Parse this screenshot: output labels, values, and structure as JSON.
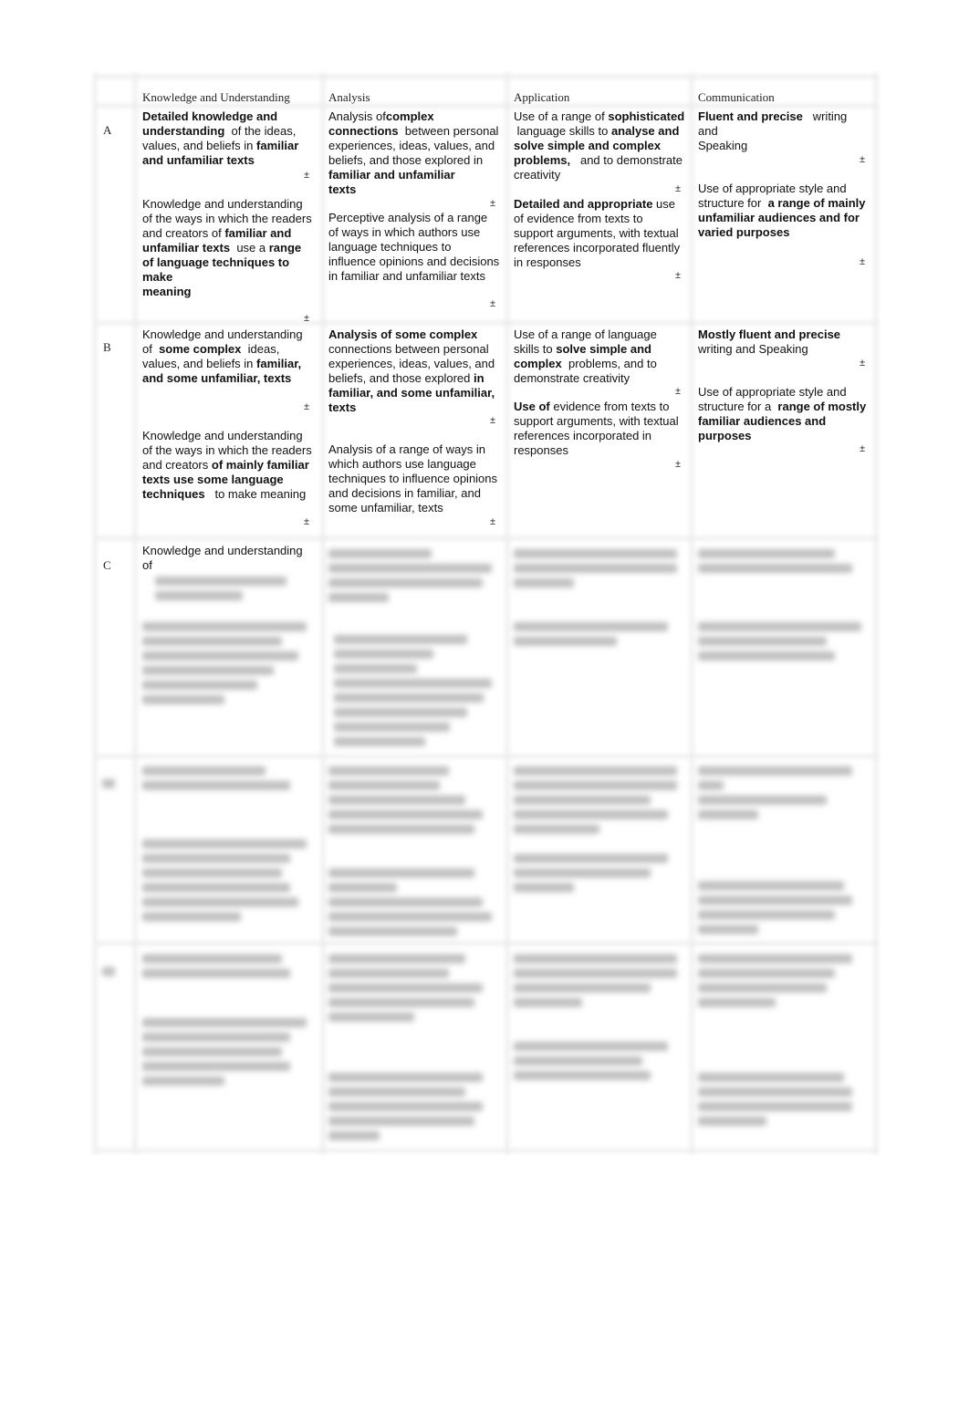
{
  "table": {
    "columns": [
      "",
      "Knowledge and Understanding",
      "Analysis",
      "Application",
      "Communication"
    ],
    "rows": [
      {
        "label": "A",
        "knowledge": [
          "<b>Detailed knowledge and understanding</b> &nbsp;of the ideas, values, and beliefs in <b>familiar and unfamiliar texts</b>",
          "Knowledge and understanding of the ways in which the readers and creators of <b>familiar and unfamiliar texts</b> &nbsp;use a <b>range of language techniques to make<br>meaning</b>"
        ],
        "analysis": [
          "Analysis of<b>complex connections</b> &nbsp;between personal experiences, ideas, values, and beliefs, and those explored in <b>familiar and unfamiliar<br>texts</b>",
          "Perceptive analysis of a range of ways in which authors use language techniques to influence opinions and decisions in familiar and unfamiliar texts"
        ],
        "application": [
          "Use of a range of <b>sophisticated</b> &nbsp;language skills to <b>analyse and solve simple and complex problems,</b> &nbsp;&nbsp;and to demonstrate creativity",
          "<b>Detailed and appropriate</b> use of evidence from texts to support arguments, with textual references incorporated fluently in responses"
        ],
        "communication": [
          "<b>Fluent and precise</b> &nbsp;&nbsp;writing and<br>Speaking",
          "Use of appropriate style and structure for &nbsp;<b>a range of mainly unfamiliar audiences and for varied purposes</b>"
        ]
      },
      {
        "label": "B",
        "knowledge": [
          "Knowledge and understanding of &nbsp;<b>some complex</b> &nbsp;ideas, values, and beliefs in <b>familiar, and some unfamiliar, texts</b>",
          "Knowledge and understanding of the ways in which the readers and creators <b>of mainly familiar texts use some language techniques</b> &nbsp;&nbsp;to make meaning"
        ],
        "analysis": [
          "<b>Analysis of some complex</b> connections between personal experiences, ideas, values, and beliefs, and those explored <b>in familiar, and some unfamiliar, texts</b>",
          "Analysis of a range of ways in which authors use language techniques to influence opinions and decisions in familiar, and some unfamiliar, texts"
        ],
        "application": [
          "Use of a range of language skills to <b>solve simple and complex</b> &nbsp;problems, and to demonstrate creativity",
          "<b>Use of</b> evidence from texts to support arguments, with textual references incorporated in responses"
        ],
        "communication": [
          "<b>Mostly fluent and precise</b> writing and Speaking",
          "Use of appropriate style and structure for a &nbsp;<b>range of mostly familiar audiences and purposes</b>"
        ]
      },
      {
        "label": "C",
        "knowledge": [
          "Knowledge and understanding of"
        ]
      }
    ],
    "marker": "±"
  }
}
